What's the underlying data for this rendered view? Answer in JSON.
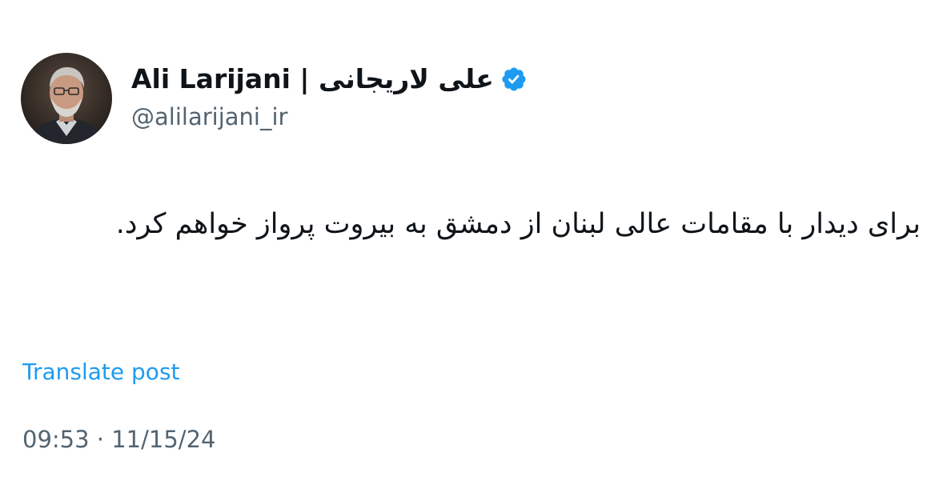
{
  "author": {
    "avatar_icon": "profile-photo",
    "display_name": "Ali Larijani | علی لاریجانی",
    "verified_icon": "verified-badge-icon",
    "handle": "@alilarijani_ir"
  },
  "post": {
    "text": "برای دیدار با مقامات عالی لبنان از دمشق به بیروت پرواز خواهم کرد.",
    "translate_label": "Translate post",
    "time": "09:53",
    "separator": "·",
    "date": "11/15/24"
  },
  "colors": {
    "text_primary": "#0f1419",
    "text_secondary": "#536471",
    "link": "#1d9bf0",
    "verified": "#1d9bf0",
    "background": "#ffffff"
  }
}
